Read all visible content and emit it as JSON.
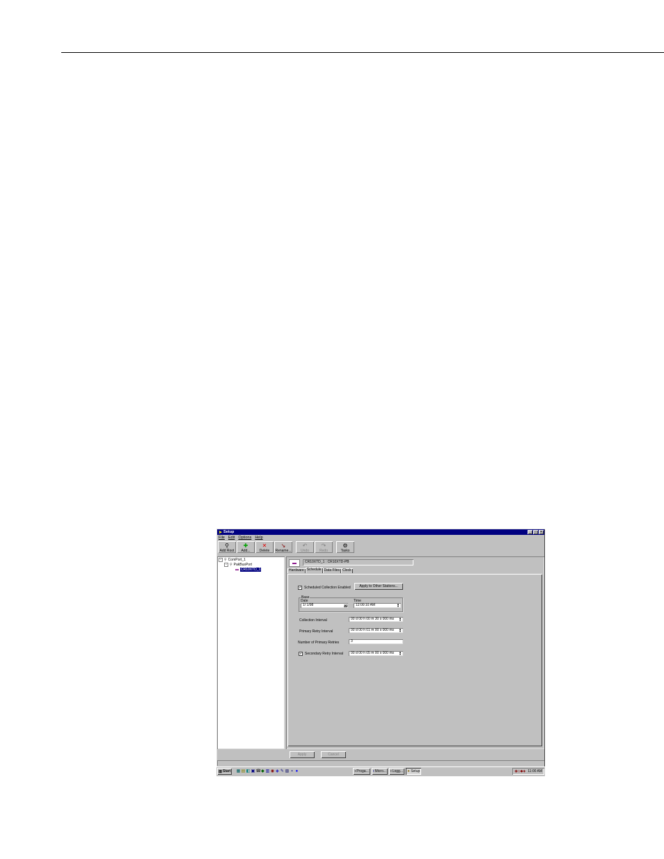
{
  "window": {
    "title": "Setup",
    "controls": {
      "minimize": "_",
      "maximize": "□",
      "close": "×"
    }
  },
  "menu": [
    "File",
    "Edit",
    "Options",
    "Help"
  ],
  "toolbar": [
    {
      "label": "Add Root",
      "icon": "add-root-icon",
      "glyph": "⚲",
      "enabled": true
    },
    {
      "label": "Add...",
      "icon": "add-icon",
      "glyph": "✚",
      "color": "#00a000",
      "enabled": true
    },
    {
      "label": "Delete",
      "icon": "delete-icon",
      "glyph": "✕",
      "color": "#e00000",
      "enabled": true
    },
    {
      "label": "Rename...",
      "icon": "rename-icon",
      "glyph": "↘",
      "enabled": true
    },
    {
      "label": "Undo",
      "icon": "undo-icon",
      "glyph": "↶",
      "enabled": false
    },
    {
      "label": "Redo",
      "icon": "redo-icon",
      "glyph": "↷",
      "enabled": false
    },
    {
      "label": "Tasks",
      "icon": "tasks-icon",
      "glyph": "⚙",
      "enabled": true
    }
  ],
  "tree": {
    "root": "ComPort_1",
    "child": "PakBusPort",
    "leaf": "CR10XTD_1"
  },
  "station_path": "CR10XTD_1 : CR10XTD-PB",
  "tabs": [
    "Hardware",
    "Schedule",
    "Data Files",
    "Clock"
  ],
  "active_tab": "Schedule",
  "schedule": {
    "scheduled_collection_label": "Scheduled Collection Enabled",
    "scheduled_collection_checked": "✔",
    "apply_other_label": "Apply to Other Stations...",
    "base_label": "Base",
    "date_label": "Date",
    "date_value": "1/  1/98",
    "time_label": "Time",
    "time_value": "12:00:10 AM",
    "collection_interval_label": "Collection Interval",
    "collection_interval_value": "00 d 00 h 00 m 30 s 000 ms",
    "primary_retry_label": "Primary Retry Interval",
    "primary_retry_value": "00 d 00 h 01 m 00 s 000 ms",
    "num_retries_label": "Number of Primary Retries",
    "num_retries_value": "3",
    "secondary_retry_label": "Secondary Retry Interval",
    "secondary_retry_checked": "✔",
    "secondary_retry_value": "00 d 00 h 05 m 00 s 000 ms"
  },
  "buttons": {
    "apply": "Apply",
    "cancel": "Cancel"
  },
  "taskbar": {
    "start": "Start",
    "tasks": [
      "Proga...",
      "Micro...",
      "Logg...",
      "Setup"
    ],
    "active_task": "Setup",
    "clock": "11:00 AM"
  }
}
